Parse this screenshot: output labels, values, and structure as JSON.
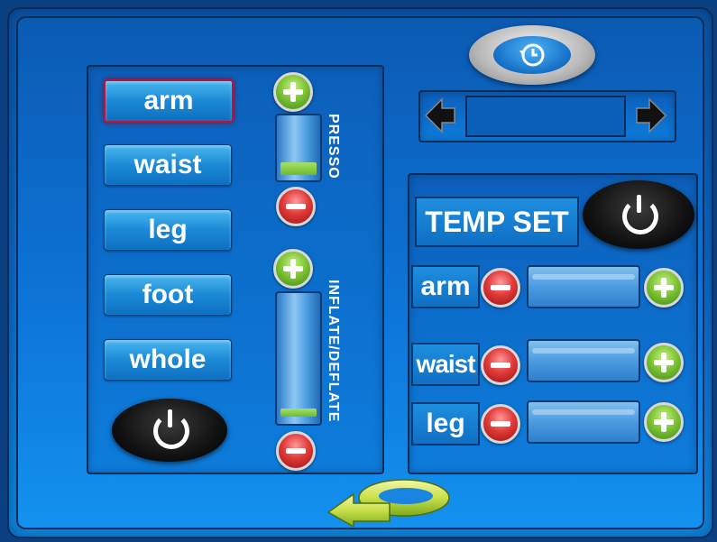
{
  "left_panel": {
    "parts": [
      {
        "label": "arm",
        "active": true
      },
      {
        "label": "waist",
        "active": false
      },
      {
        "label": "leg",
        "active": false
      },
      {
        "label": "foot",
        "active": false
      },
      {
        "label": "whole",
        "active": false
      }
    ],
    "presso": {
      "label": "PRESSO",
      "level_fraction": 0.25
    },
    "inflate": {
      "label": "INFLATE/DEFLATE",
      "level_fraction": 0.07
    }
  },
  "temp_panel": {
    "title": "TEMP SET",
    "rows": [
      {
        "label": "arm"
      },
      {
        "label": "waist"
      },
      {
        "label": "leg"
      }
    ]
  },
  "timer": {
    "icon": "clock-icon",
    "display_value": ""
  },
  "colors": {
    "plus": "#7fc536",
    "minus": "#e23b3b",
    "accent": "#0d76da"
  }
}
